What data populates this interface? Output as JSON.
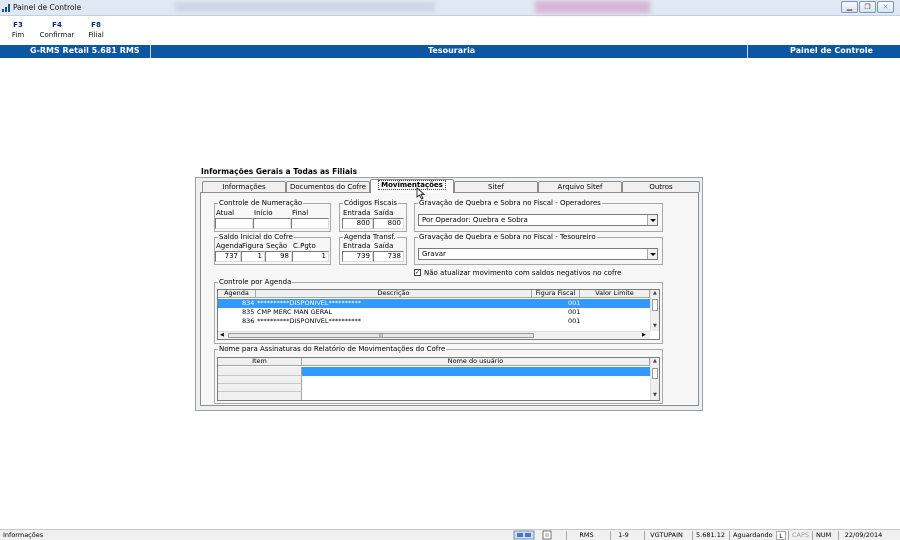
{
  "window": {
    "title": "Painel de Controle"
  },
  "toolbar": {
    "keys": [
      {
        "key": "F3",
        "label": "Fim"
      },
      {
        "key": "F4",
        "label": "Confirmar"
      },
      {
        "key": "F8",
        "label": "Filial"
      }
    ]
  },
  "header": {
    "left": "G-RMS Retail 5.681 RMS",
    "center": "Tesouraria",
    "right": "Painel de Controle"
  },
  "panel": {
    "title": "Informações Gerais a Todas as Filiais",
    "tabs": [
      "Informações",
      "Documentos do Cofre",
      "Movimentações",
      "Sitef",
      "Arquivo Sitef",
      "Outros"
    ],
    "active_tab": "Movimentações",
    "controle_numeracao": {
      "title": "Controle de Numeração",
      "cols": [
        "Atual",
        "Início",
        "Final"
      ],
      "values": [
        "",
        "",
        ""
      ]
    },
    "codigos_fiscais": {
      "title": "Códigos Fiscais",
      "cols": [
        "Entrada",
        "Saída"
      ],
      "values": [
        "800",
        "800"
      ]
    },
    "gravacao_operadores": {
      "title": "Gravação de Quebra e Sobra no Fiscal - Operadores",
      "value": "Por Operador: Quebra e Sobra"
    },
    "saldo_inicial": {
      "title": "Saldo Inicial do Cofre",
      "cols": [
        "Agenda",
        "Figura",
        "Seção",
        "C.Pgto"
      ],
      "values": [
        "737",
        "1",
        "98",
        "1"
      ]
    },
    "agenda_transf": {
      "title": "Agenda Transf.",
      "cols": [
        "Entrada",
        "Saída"
      ],
      "values": [
        "739",
        "738"
      ]
    },
    "gravacao_tesoureiro": {
      "title": "Gravação de Quebra e Sobra no Fiscal - Tesoureiro",
      "value": "Gravar"
    },
    "checkbox": {
      "label": "Não atualizar movimento com saldos negativos no cofre",
      "checked": true
    },
    "controle_agenda": {
      "title": "Controle por Agenda",
      "columns": [
        "Agenda",
        "Descrição",
        "Figura Fiscal",
        "Valor Limite"
      ],
      "rows": [
        {
          "agenda": "834",
          "descricao": "**********DISPONIVEL**********",
          "figura": "001",
          "valor": "",
          "selected": true
        },
        {
          "agenda": "835",
          "descricao": "CMP MERC MAN GERAL",
          "figura": "001",
          "valor": "",
          "selected": false
        },
        {
          "agenda": "836",
          "descricao": "**********DISPONIVEL**********",
          "figura": "001",
          "valor": "",
          "selected": false
        }
      ],
      "hscroll_thumb": "III"
    },
    "assinaturas": {
      "title": "Nome para Assinaturas do Relatório de Movimentações do Cofre",
      "columns": [
        "Item",
        "Nome do usuário"
      ]
    }
  },
  "statusbar": {
    "left": "Informações",
    "cells": [
      "RMS",
      "1-9",
      "VGTUPAIN",
      "5.681.12",
      "Aguardando",
      "L",
      "CAPS",
      "NUM",
      "22/09/2014"
    ]
  },
  "colors": {
    "header_blue": "#0b57a4",
    "selection": "#3399ff"
  }
}
